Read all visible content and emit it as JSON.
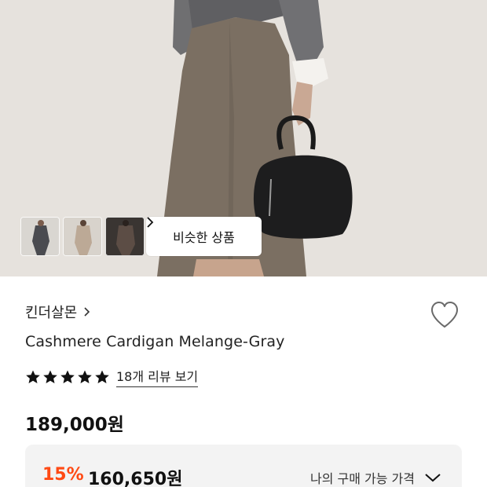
{
  "hero": {
    "thumbnails": [
      "thumbnail-1",
      "thumbnail-2",
      "thumbnail-3"
    ],
    "similar_button_label": "비슷한 상품"
  },
  "product": {
    "brand": "킨더살몬",
    "name": "Cashmere Cardigan Melange-Gray",
    "rating_stars": 5,
    "review_link": "18개 리뷰 보기",
    "price": "189,000원",
    "discount_percent": "15%",
    "discount_price": "160,650원",
    "my_price_label": "나의 구매 가능 가격"
  },
  "colors": {
    "discount": "#ff4a14",
    "background": "#e6e2dd",
    "price_box": "#f3f3f3"
  },
  "icons": {
    "brand_chevron": "chevron-right-icon",
    "similar_chevron": "chevron-right-icon",
    "wishlist": "heart-icon",
    "star": "star-icon",
    "expand": "chevron-down-icon"
  }
}
